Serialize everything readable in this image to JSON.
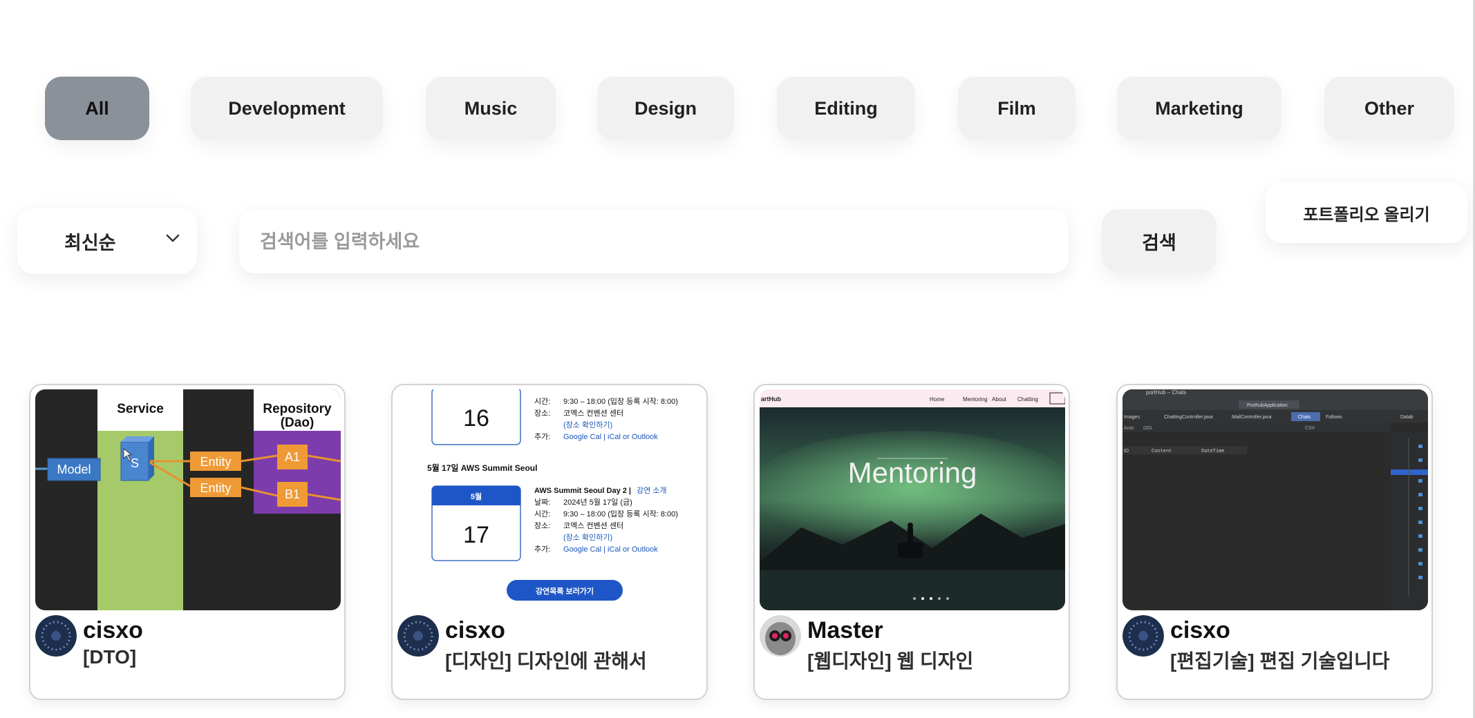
{
  "categories": [
    {
      "label": "All",
      "active": true
    },
    {
      "label": "Development",
      "active": false
    },
    {
      "label": "Music",
      "active": false
    },
    {
      "label": "Design",
      "active": false
    },
    {
      "label": "Editing",
      "active": false
    },
    {
      "label": "Film",
      "active": false
    },
    {
      "label": "Marketing",
      "active": false
    },
    {
      "label": "Other",
      "active": false
    }
  ],
  "sort": {
    "label": "최신순"
  },
  "search": {
    "placeholder": "검색어를 입력하세요",
    "value": "",
    "button_label": "검색"
  },
  "upload": {
    "label": "포트폴리오 올리기"
  },
  "cards": [
    {
      "author": "cisxo",
      "title": "[DTO]",
      "thumbnail": {
        "columns": [
          "Service",
          "Repository",
          "(Dao)"
        ],
        "boxes": [
          "Model",
          "S",
          "Entity",
          "Entity",
          "A1",
          "B1"
        ]
      }
    },
    {
      "author": "cisxo",
      "title": "[디자인] 디자인에 관해서",
      "thumbnail": {
        "date_top": "16",
        "top_rows": [
          {
            "key": "시간:",
            "val": "9:30 – 18:00 (입장 등록 시작: 8:00)"
          },
          {
            "key": "장소:",
            "val": "코엑스 컨벤션 센터"
          },
          {
            "key": "",
            "val": "(장소 확인하기)"
          },
          {
            "key": "추가:",
            "val": "Google Cal | iCal or Outlook"
          }
        ],
        "heading": "5월 17일 AWS Summit Seoul",
        "month": "5월",
        "date": "17",
        "event_title": "AWS Summit Seoul Day 2 |",
        "event_link": "강연 소개",
        "rows": [
          {
            "key": "날짜:",
            "val": "2024년 5월 17일 (금)"
          },
          {
            "key": "시간:",
            "val": "9:30 – 18:00 (입장 등록 시작: 8:00)"
          },
          {
            "key": "장소:",
            "val": "코엑스 컨벤션 센터"
          },
          {
            "key": "",
            "val": "(장소 확인하기)"
          },
          {
            "key": "추가:",
            "val": "Google Cal | iCal or Outlook"
          }
        ],
        "button": "강연목록 보러가기"
      }
    },
    {
      "author": "Master",
      "title": "[웹디자인] 웹 디자인",
      "thumbnail": {
        "brand": "artHub",
        "nav": [
          "Home",
          "Mentoring",
          "About",
          "Chatting"
        ],
        "hero_text": "Mentoring"
      }
    },
    {
      "author": "cisxo",
      "title": "[편집기술] 편집 기술입니다",
      "thumbnail": {
        "window_title": "portHub – Chats",
        "run_config": "PorthubApplication",
        "tabs": [
          "Images",
          "ChattingController.java",
          "MailController.java",
          "Chats",
          "Follows"
        ],
        "columns": [
          "ID",
          "Content",
          "DateTime"
        ],
        "toolbar": [
          "Auto",
          "DDL",
          "CSV"
        ],
        "side_label": "Datab"
      }
    }
  ],
  "colors": {
    "active_category": "#8b9199",
    "category_bg": "#f1f1f1",
    "link_blue": "#1a56b8"
  }
}
